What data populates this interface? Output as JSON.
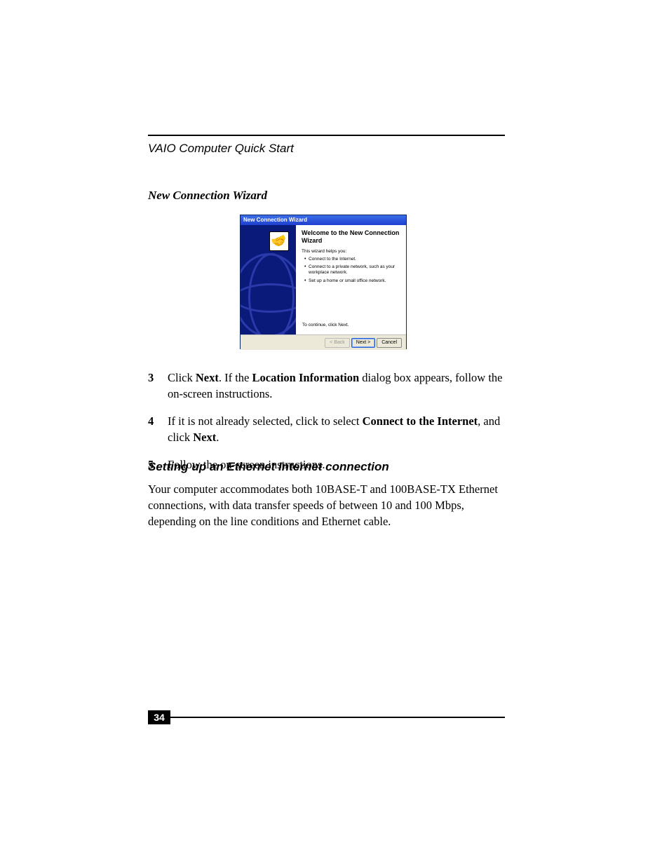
{
  "header": {
    "title": "VAIO Computer Quick Start"
  },
  "caption": "New Connection Wizard",
  "wizard": {
    "titlebar": "New Connection Wizard",
    "welcome": "Welcome to the New Connection Wizard",
    "intro": "This wizard helps you:",
    "bullets": [
      "Connect to the Internet.",
      "Connect to a private network, such as your workplace network.",
      "Set up a home or small office network."
    ],
    "continue": "To continue, click Next.",
    "buttons": {
      "back": "< Back",
      "next": "Next >",
      "cancel": "Cancel"
    }
  },
  "steps": [
    {
      "num": "3",
      "parts": [
        "Click ",
        "Next",
        ". If the ",
        "Location Information",
        " dialog box appears, follow the on-screen instructions."
      ]
    },
    {
      "num": "4",
      "parts": [
        "If it is not already selected, click to select ",
        "Connect to the Internet",
        ", and click ",
        "Next",
        "."
      ]
    },
    {
      "num": "5",
      "parts": [
        "Follow the on-screen instructions."
      ]
    }
  ],
  "subheading": "Setting up an Ethernet Internet connection",
  "body": "Your computer accommodates both 10BASE-T and 100BASE-TX Ethernet connections, with data transfer speeds of between 10 and 100 Mbps, depending on the line conditions and Ethernet cable.",
  "pagenum": "34"
}
